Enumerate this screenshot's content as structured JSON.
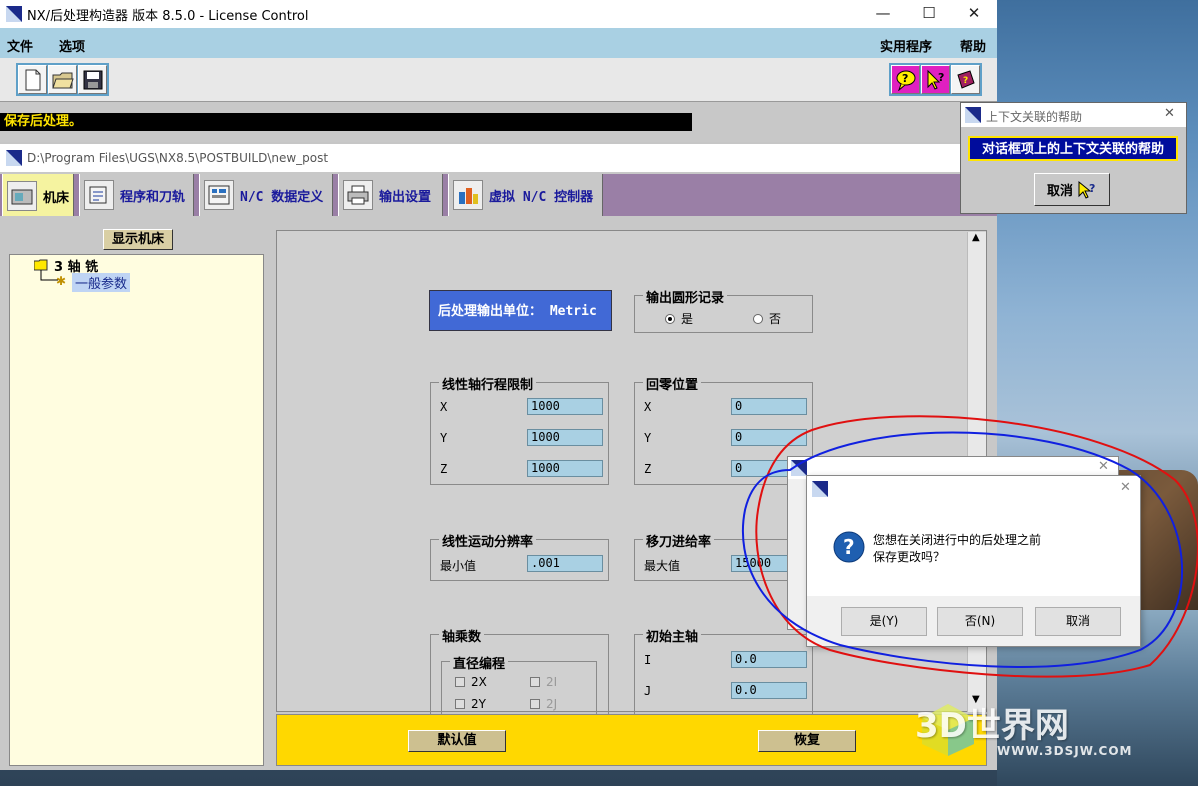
{
  "window": {
    "title": "NX/后处理构造器 版本 8.5.0 - License Control"
  },
  "menu": {
    "file": "文件",
    "options": "选项",
    "utilities": "实用程序",
    "help": "帮助"
  },
  "status": "保存后处理。",
  "inner_window": {
    "path": "D:\\Program Files\\UGS\\NX8.5\\POSTBUILD\\new_post"
  },
  "tabs": [
    {
      "label": "机床"
    },
    {
      "label": "程序和刀轨"
    },
    {
      "label": "N/C 数据定义"
    },
    {
      "label": "输出设置"
    },
    {
      "label": "虚拟 N/C 控制器"
    }
  ],
  "left_pane": {
    "show_machine": "显示机床",
    "tree_root": "3 轴 铣",
    "tree_child": "一般参数"
  },
  "content": {
    "unit_label": "后处理输出单位： Metric",
    "circular": {
      "title": "输出圆形记录",
      "yes": "是",
      "no": "否"
    },
    "linear_limits": {
      "title": "线性轴行程限制",
      "x_label": "X",
      "x": "1000",
      "y_label": "Y",
      "y": "1000",
      "z_label": "Z",
      "z": "1000"
    },
    "home": {
      "title": "回零位置",
      "x_label": "X",
      "x": "0",
      "y_label": "Y",
      "y": "0",
      "z_label": "Z",
      "z": "0"
    },
    "resolution": {
      "title": "线性运动分辨率",
      "min_label": "最小值",
      "min": ".001"
    },
    "traverse": {
      "title": "移刀进给率",
      "max_label": "最大值",
      "max": "15000"
    },
    "multipliers": {
      "title": "轴乘数",
      "diameter_title": "直径编程",
      "c2x": "2X",
      "c2i": "2I",
      "c2y": "2Y",
      "c2j": "2J"
    },
    "spindle": {
      "title": "初始主轴",
      "i_label": "I",
      "i": "0.0",
      "j_label": "J",
      "j": "0.0"
    }
  },
  "bottom": {
    "default": "默认值",
    "restore": "恢复"
  },
  "help_window": {
    "title": "上下文关联的帮助",
    "message": "对话框项上的上下文关联的帮助",
    "cancel": "取消"
  },
  "dialog": {
    "line1": "您想在关闭进行中的后处理之前",
    "line2": "保存更改吗？",
    "yes": "是(Y)",
    "no": "否(N)",
    "cancel": "取消"
  },
  "watermark": {
    "brand": "3D世界网",
    "url": "WWW.3DSJW.COM"
  },
  "colors": {
    "menubar": "#a9d0e3",
    "tab_strip": "#9a7fa6",
    "accent_blue": "#4169d6",
    "bottom_bar": "#ffd800",
    "annotation_red": "#e01010",
    "annotation_blue": "#1020e0"
  }
}
